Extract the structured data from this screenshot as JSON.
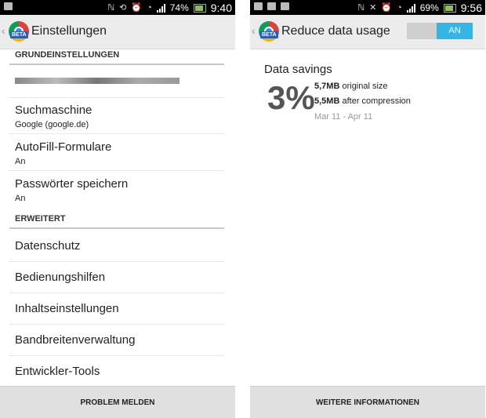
{
  "left": {
    "status_bar": {
      "battery": "74%",
      "time": "9:40"
    },
    "title": "Einstellungen",
    "beta": "BETA",
    "sections": [
      {
        "header": "GRUNDEINSTELLUNGEN"
      },
      {
        "header": "ERWEITERT"
      }
    ],
    "items": [
      {
        "title": "Suchmaschine",
        "subtitle": "Google (google.de)"
      },
      {
        "title": "AutoFill-Formulare",
        "subtitle": "An"
      },
      {
        "title": "Passwörter speichern",
        "subtitle": "An"
      },
      {
        "title": "Datenschutz"
      },
      {
        "title": "Bedienungshilfen"
      },
      {
        "title": "Inhaltseinstellungen"
      },
      {
        "title": "Bandbreitenverwaltung"
      },
      {
        "title": "Entwickler-Tools"
      }
    ],
    "bottom_button": "PROBLEM MELDEN"
  },
  "right": {
    "status_bar": {
      "battery": "69%",
      "time": "9:56"
    },
    "title": "Reduce data usage",
    "beta": "BETA",
    "toggle": "AN",
    "data_savings": {
      "title": "Data savings",
      "percent": "3%",
      "original_value": "5,7MB",
      "original_label": "original size",
      "compressed_value": "5,5MB",
      "compressed_label": "after compression",
      "range": "Mar 11 - Apr 11"
    },
    "bottom_button": "WEITERE INFORMATIONEN"
  }
}
